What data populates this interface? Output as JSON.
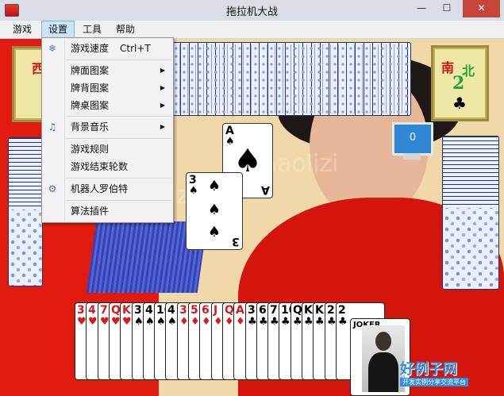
{
  "window": {
    "title": "拖拉机大战",
    "minimize": "—",
    "maximize": "☐",
    "close": "✕"
  },
  "menubar": {
    "items": [
      "游戏",
      "设置",
      "工具",
      "帮助"
    ]
  },
  "settings_menu": {
    "items": [
      {
        "label": "游戏速度",
        "shortcut": "Ctrl+T",
        "icon": "snowflake-icon"
      },
      {
        "label": "牌面图案",
        "arrow": "▶"
      },
      {
        "label": "牌背图案",
        "arrow": "▶"
      },
      {
        "label": "牌桌图案",
        "arrow": "▶"
      },
      {
        "label": "背景音乐",
        "arrow": "▶",
        "icon": "music-note-icon"
      },
      {
        "label": "游戏规则"
      },
      {
        "label": "游戏结束轮数"
      },
      {
        "label": "机器人罗伯特",
        "icon": "robot-icon"
      },
      {
        "label": "算法插件"
      }
    ]
  },
  "players": {
    "west": {
      "seat": "西"
    },
    "south": {
      "seat": "南",
      "role": "北",
      "level": "2",
      "suit": "♣"
    }
  },
  "monitor": {
    "score": "0"
  },
  "played_cards": [
    {
      "rank": "A",
      "suit": "♠",
      "color": "black"
    },
    {
      "rank": "3",
      "suit": "♠",
      "color": "black"
    }
  ],
  "hand": [
    {
      "rank": "3",
      "suit": "♥"
    },
    {
      "rank": "4",
      "suit": "♥"
    },
    {
      "rank": "7",
      "suit": "♥"
    },
    {
      "rank": "Q",
      "suit": "♥"
    },
    {
      "rank": "K",
      "suit": "♥"
    },
    {
      "rank": "3",
      "suit": "♠"
    },
    {
      "rank": "4",
      "suit": "♠"
    },
    {
      "rank": "10",
      "suit": "♠"
    },
    {
      "rank": "4",
      "suit": "♠"
    },
    {
      "rank": "3",
      "suit": "♦"
    },
    {
      "rank": "5",
      "suit": "♦"
    },
    {
      "rank": "6",
      "suit": "♦"
    },
    {
      "rank": "J",
      "suit": "♦"
    },
    {
      "rank": "Q",
      "suit": "♦"
    },
    {
      "rank": "A",
      "suit": "♦"
    },
    {
      "rank": "3",
      "suit": "♣"
    },
    {
      "rank": "6",
      "suit": "♣"
    },
    {
      "rank": "7",
      "suit": "♣"
    },
    {
      "rank": "10",
      "suit": "♣"
    },
    {
      "rank": "Q",
      "suit": "♣"
    },
    {
      "rank": "K",
      "suit": "♣"
    },
    {
      "rank": "K",
      "suit": "♣"
    },
    {
      "rank": "2",
      "suit": "♣"
    },
    {
      "rank": "2",
      "suit": "♣"
    }
  ],
  "joker": {
    "word": "JOKER"
  },
  "watermarks": [
    "haolizi",
    "haolizi",
    "haolizi"
  ],
  "brand": {
    "name": "好例子网",
    "sub": "开发实例分享交流平台"
  }
}
